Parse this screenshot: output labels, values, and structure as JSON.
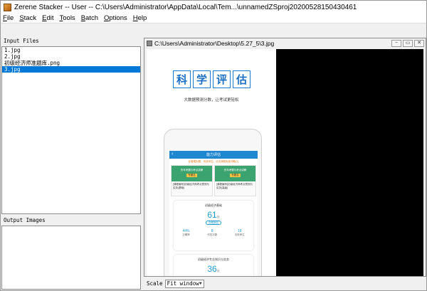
{
  "window": {
    "title": "Zerene Stacker -- User -- C:\\Users\\Administrator\\AppData\\Local\\Tem...\\unnamedZSproj20200528150430461"
  },
  "menu": {
    "items": [
      {
        "u": "F",
        "rest": "ile"
      },
      {
        "u": "S",
        "rest": "tack"
      },
      {
        "u": "E",
        "rest": "dit"
      },
      {
        "u": "T",
        "rest": "ools"
      },
      {
        "u": "B",
        "rest": "atch"
      },
      {
        "u": "O",
        "rest": "ptions"
      },
      {
        "u": "H",
        "rest": "elp"
      }
    ]
  },
  "input_files": {
    "label": "Input Files",
    "items": [
      "1.jpg",
      "2.jpg",
      "初级经济师准题库.png",
      "3.jpg"
    ],
    "selected_index": 3
  },
  "output_images": {
    "label": "Output Images"
  },
  "viewer": {
    "path": "C:\\Users\\Administrator\\Desktop\\5.27_5\\3.jpg",
    "buttons": {
      "minimize": "−",
      "restore": "▭",
      "close": "✕"
    }
  },
  "photo": {
    "heading_chars": [
      "科",
      "学",
      "评",
      "估"
    ],
    "subline": "大数据预测分数，让考试更轻松",
    "app_title": "能力评估",
    "app_note": "全套模拟题，系统评估，点击课程免费领取(1)",
    "card1_banner": "历年考题与考点讲解",
    "card1_tag": "专题名",
    "card1_text": "[课程编号]初级经济师考点预测与实务(基础)",
    "card2_banner": "历年考题与考点讲解",
    "card2_tag": "专题名",
    "card2_text": "[课程编号]初级经济师考点预测与实务(高级)",
    "score1_title": "初级经济基础",
    "score1_value": "61",
    "score1_unit": "分",
    "score1_pill": "查看报告",
    "stats": [
      {
        "value": "44%",
        "label": "正确率"
      },
      {
        "value": "8",
        "label": "作答次数"
      },
      {
        "value": "18",
        "label": "击败考生"
      }
    ],
    "score2_title": "初级经济专业知识与实务",
    "score2_value": "36",
    "score2_unit": "分"
  },
  "footer": {
    "scale_label": "Scale",
    "scale_value": "Fit window"
  }
}
